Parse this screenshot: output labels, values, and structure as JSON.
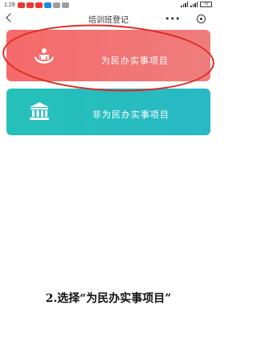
{
  "status_bar": {
    "time": "1:29",
    "battery": "76"
  },
  "nav": {
    "title": "培训班登记"
  },
  "cards": [
    {
      "label": "为民办实事项目",
      "color": "#f26c6c"
    },
    {
      "label": "非为民办实事项目",
      "color": "#26bfbc"
    }
  ],
  "highlight": {
    "color": "#e0281e"
  },
  "caption": "2.选择“为民办实事项目”"
}
